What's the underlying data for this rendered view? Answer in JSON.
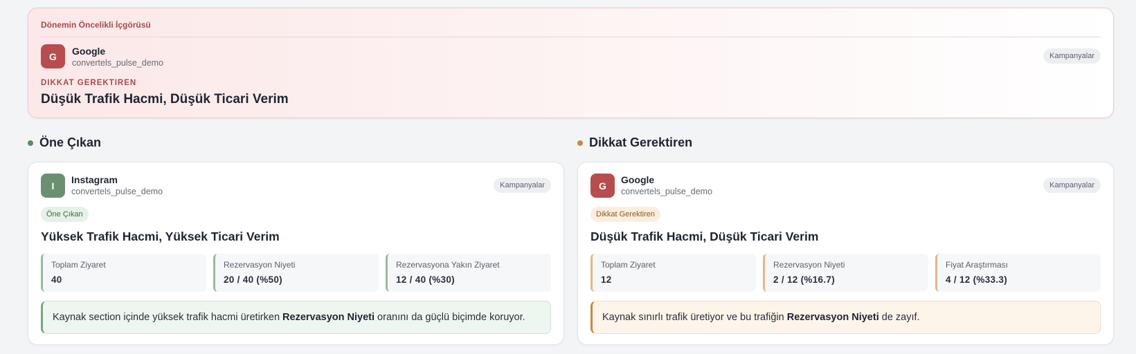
{
  "hero": {
    "title": "Dönemin Öncelikli İçgörüsü",
    "avatar_letter": "G",
    "source_name": "Google",
    "account": "convertels_pulse_demo",
    "tag": "Kampanyalar",
    "status": "DIKKAT GEREKTIREN",
    "headline": "Düşük Trafik Hacmi, Düşük Ticari Verim"
  },
  "sections": {
    "highlight": {
      "title": "Öne Çıkan",
      "card": {
        "avatar_letter": "I",
        "source_name": "Instagram",
        "account": "convertels_pulse_demo",
        "tag": "Kampanyalar",
        "badge": "Öne Çıkan",
        "headline": "Yüksek Trafik Hacmi, Yüksek Ticari Verim",
        "metrics": [
          {
            "label": "Toplam Ziyaret",
            "value": "40"
          },
          {
            "label": "Rezervasyon Niyeti",
            "value": "20 / 40 (%50)"
          },
          {
            "label": "Rezervasyona Yakın Ziyaret",
            "value": "12 / 40 (%30)"
          }
        ],
        "note": {
          "before": "Kaynak section içinde yüksek trafik hacmi üretirken ",
          "bold": "Rezervasyon Niyeti",
          "after": " oranını da güçlü biçimde koruyor."
        }
      }
    },
    "attention": {
      "title": "Dikkat Gerektiren",
      "card": {
        "avatar_letter": "G",
        "source_name": "Google",
        "account": "convertels_pulse_demo",
        "tag": "Kampanyalar",
        "badge": "Dikkat Gerektiren",
        "headline": "Düşük Trafik Hacmi, Düşük Ticari Verim",
        "metrics": [
          {
            "label": "Toplam Ziyaret",
            "value": "12"
          },
          {
            "label": "Rezervasyon Niyeti",
            "value": "2 / 12 (%16.7)"
          },
          {
            "label": "Fiyat Araştırması",
            "value": "4 / 12 (%33.3)"
          }
        ],
        "note": {
          "before": "Kaynak sınırlı trafik üretiyor ve bu trafiğin ",
          "bold": "Rezervasyon Niyeti",
          "after": " de zayıf."
        }
      }
    }
  },
  "colors": {
    "danger": "#a8494b",
    "google_avatar": "#b84c4e",
    "instagram_avatar": "#6c8f72",
    "highlight_dot": "#5d8a67",
    "attention_dot": "#c7893b"
  }
}
